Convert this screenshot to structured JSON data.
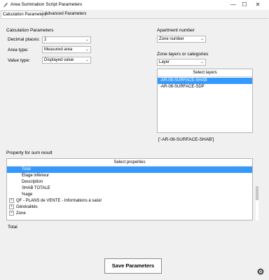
{
  "window": {
    "title": "Area Summation Script Parameters",
    "minimize": "—",
    "maximize": "☐",
    "close": "✕"
  },
  "tabs": [
    {
      "label": "Calculation Parameters",
      "active": true
    },
    {
      "label": "Advanced Parameters",
      "active": false
    }
  ],
  "calc_params": {
    "heading": "Calculation Parameters",
    "decimal_label": "Decimal places:",
    "decimal_value": "2",
    "area_type_label": "Area type:",
    "area_type_value": "Measured area",
    "value_type_label": "Value type:",
    "value_type_value": "Displayed value"
  },
  "apartment": {
    "heading": "Apartment number",
    "value": "Zone number"
  },
  "zone_layers": {
    "heading": "Zone layers or categories",
    "mode_value": "Layer",
    "list_header": "Select layers",
    "items": [
      {
        "label": "-AR-08-SURFACE-SHAB",
        "selected": true
      },
      {
        "label": "-AR-08-SURFACE-SDP",
        "selected": false
      }
    ],
    "selection_summary": "['-AR-08-SURFACE-SHAB']"
  },
  "property_sum": {
    "heading": "Property for sum result",
    "list_header": "Select properties",
    "items": [
      {
        "label": "Total",
        "selected": true,
        "expandable": false
      },
      {
        "label": "Etage inférieur",
        "selected": false,
        "expandable": false
      },
      {
        "label": "Description",
        "selected": false,
        "expandable": false
      },
      {
        "label": "SHAB TOTALE",
        "selected": false,
        "expandable": false
      },
      {
        "label": "%age",
        "selected": false,
        "expandable": false
      },
      {
        "label": "QF - PLANS de VENTE - Informations à saisir",
        "selected": false,
        "expandable": true
      },
      {
        "label": "Généralités",
        "selected": false,
        "expandable": true
      },
      {
        "label": "Zone",
        "selected": false,
        "expandable": true
      }
    ],
    "selection_summary": "Total"
  },
  "save_button": "Save Parameters",
  "colors": {
    "selection": "#3399ff",
    "background": "#f0f0f0"
  },
  "icons": {
    "app": "feather-icon",
    "corner": "settings-gear-icon"
  }
}
